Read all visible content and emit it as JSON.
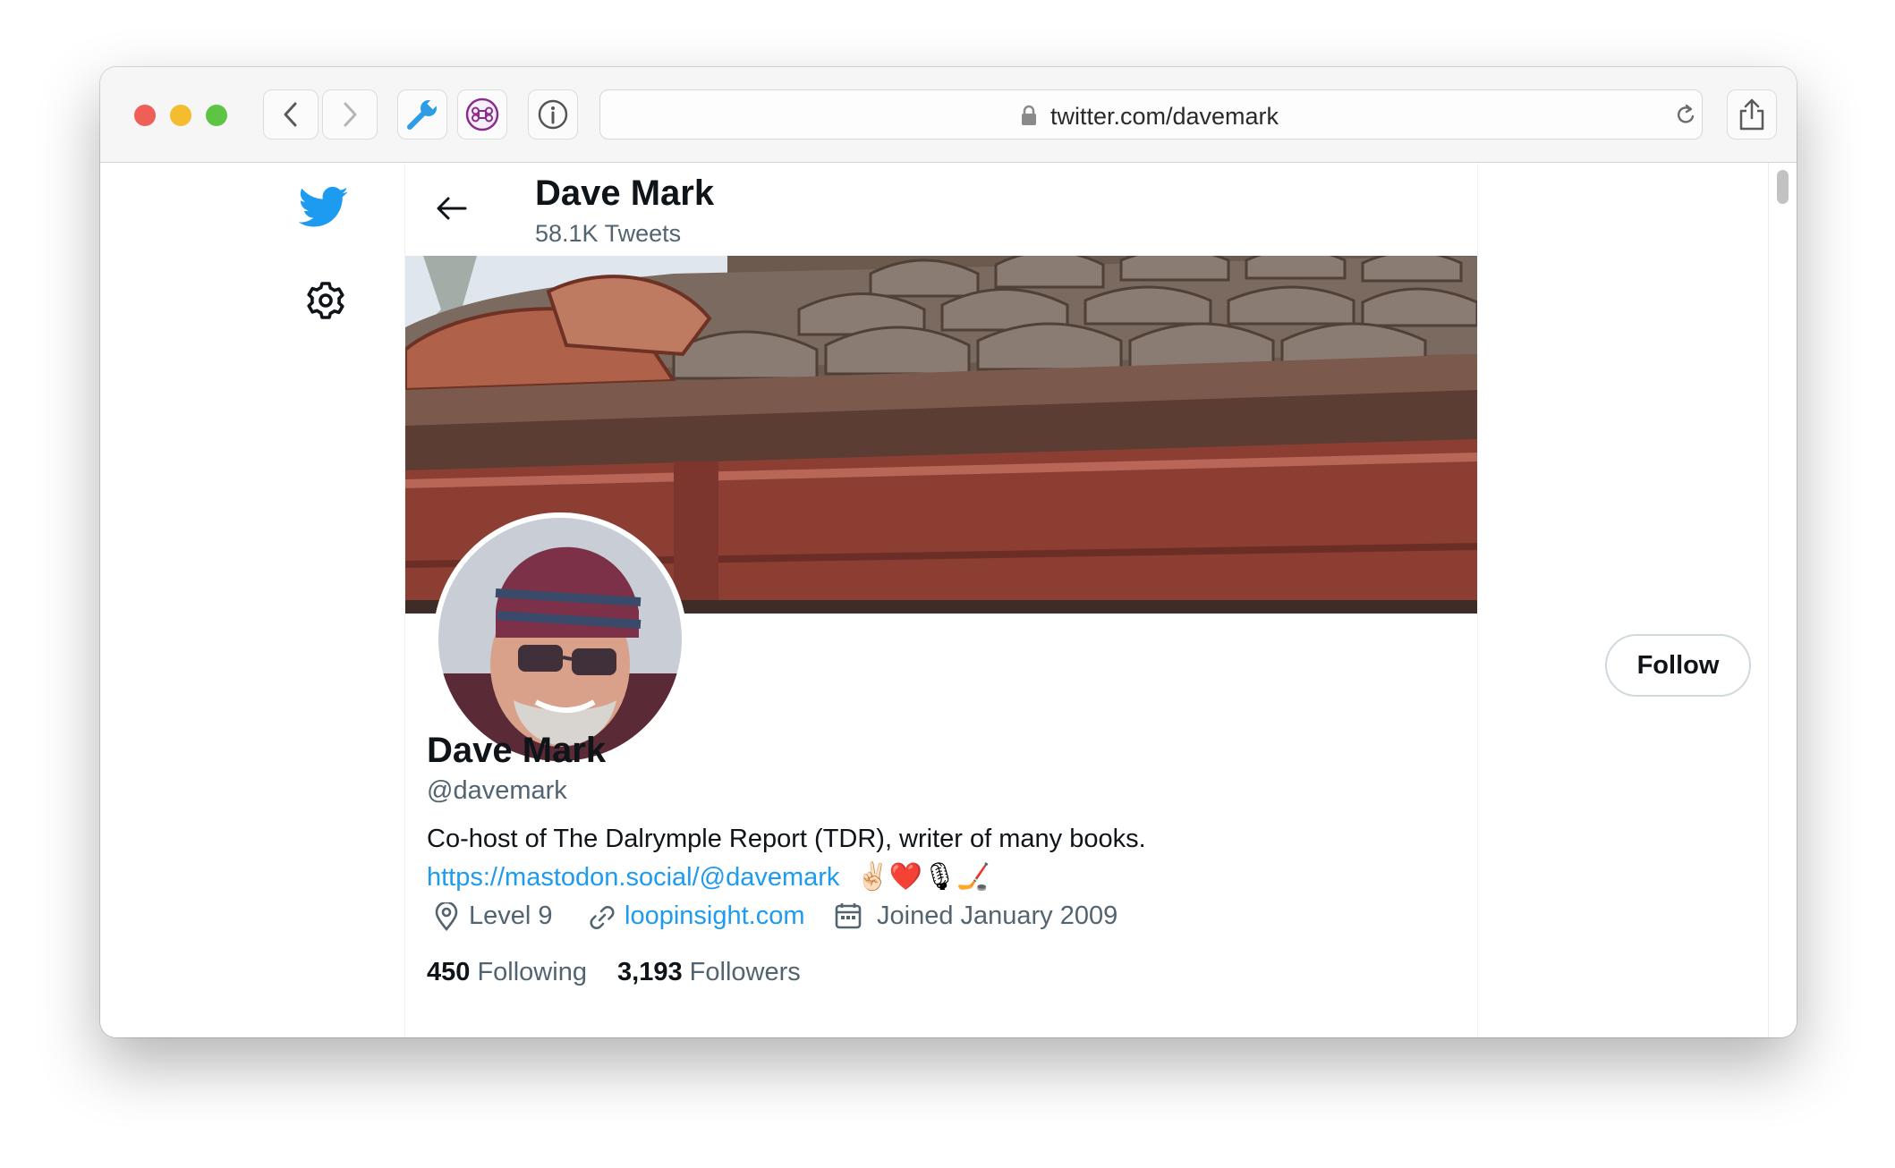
{
  "browser": {
    "url": "twitter.com/davemark",
    "extensions": [
      "wrench-icon",
      "command-icon",
      "info-icon"
    ]
  },
  "nav": {
    "icons": [
      "twitter-bird-icon",
      "settings-gear-icon"
    ]
  },
  "profile_header": {
    "name": "Dave Mark",
    "tweet_count": "58.1K Tweets"
  },
  "profile": {
    "name": "Dave Mark",
    "handle": "@davemark",
    "follow_label": "Follow",
    "bio_line1": "Co-host of The Dalrymple Report (TDR), writer of many books.",
    "bio_link": "https://mastodon.social/@davemark",
    "bio_emojis": "✌🏻❤️🎙🏒",
    "location": "Level 9",
    "website": "loopinsight.com",
    "joined": "Joined January 2009",
    "following_count": "450",
    "following_label": "Following",
    "followers_count": "3,193",
    "followers_label": "Followers"
  },
  "colors": {
    "link": "#1d9bf0",
    "twitter_blue": "#1d9bf0",
    "text_primary": "#0f1419",
    "text_secondary": "#536471",
    "traffic_close": "#ed5f57",
    "traffic_minimize": "#f4bd30",
    "traffic_zoom": "#5ec445"
  }
}
